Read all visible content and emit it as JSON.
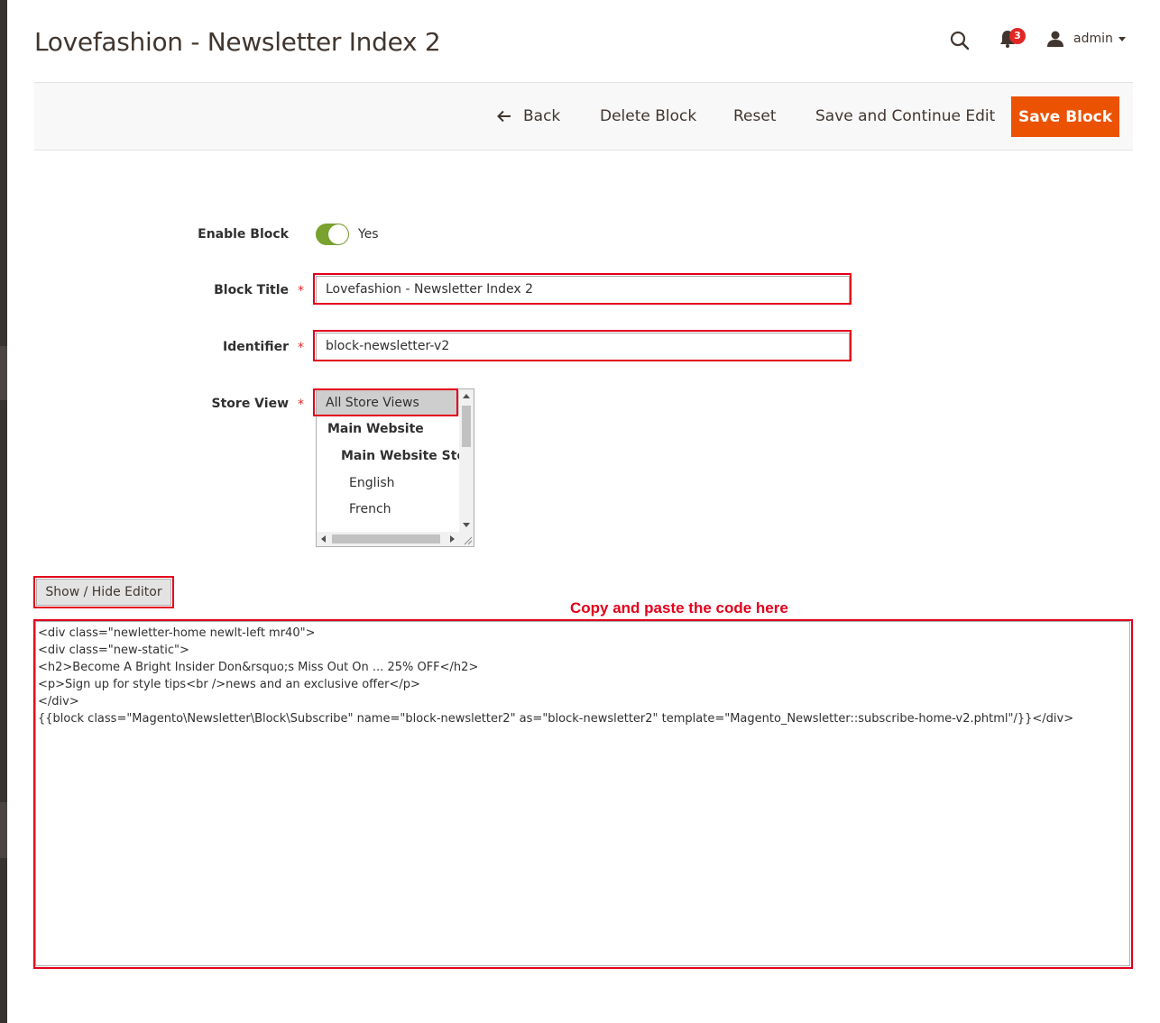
{
  "header": {
    "title": "Lovefashion - Newsletter Index 2",
    "notifications_count": "3",
    "user_name": "admin"
  },
  "toolbar": {
    "back_label": "Back",
    "delete_label": "Delete Block",
    "reset_label": "Reset",
    "save_continue_label": "Save and Continue Edit",
    "save_label": "Save Block"
  },
  "form": {
    "enable_block": {
      "label": "Enable Block",
      "value_text": "Yes",
      "enabled": true
    },
    "block_title": {
      "label": "Block Title",
      "value": "Lovefashion - Newsletter Index 2"
    },
    "identifier": {
      "label": "Identifier",
      "value": "block-newsletter-v2"
    },
    "store_view": {
      "label": "Store View",
      "options": [
        {
          "label": "All Store Views",
          "selected": true
        },
        {
          "label": "Main Website",
          "group": true
        },
        {
          "label": "Main Website Store",
          "group": true
        },
        {
          "label": "English"
        },
        {
          "label": "French"
        }
      ]
    }
  },
  "editor": {
    "toggle_label": "Show / Hide Editor",
    "annotation": "Copy and paste the code here",
    "content": "<div class=\"newletter-home newlt-left mr40\">\n<div class=\"new-static\">\n<h2>Become A Bright Insider Don&rsquo;s Miss Out On ... 25% OFF</h2>\n<p>Sign up for style tips<br />news and an exclusive offer</p>\n</div>\n{{block class=\"Magento\\Newsletter\\Block\\Subscribe\" name=\"block-newsletter2\" as=\"block-newsletter2\" template=\"Magento_Newsletter::subscribe-home-v2.phtml\"/}}</div>"
  },
  "colors": {
    "accent": "#eb5202",
    "highlight_red": "#e3001b",
    "toggle_on": "#79a22e"
  },
  "icons": {
    "search": "search-icon",
    "notifications": "bell-icon",
    "user": "user-icon",
    "back": "arrow-left-icon"
  }
}
